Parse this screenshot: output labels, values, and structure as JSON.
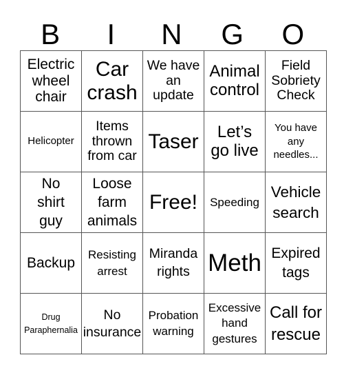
{
  "header": {
    "letters": [
      "B",
      "I",
      "N",
      "G",
      "O"
    ]
  },
  "grid": {
    "rows": [
      [
        "Electric wheel chair",
        "Car crash",
        "We have an update",
        "Animal control",
        "Field Sobriety Check"
      ],
      [
        "Helicopter",
        "Items thrown from car",
        "Taser",
        "Let’s go live",
        "You have any needles..."
      ],
      [
        "No shirt guy",
        "Loose farm animals",
        "Free!",
        "Speeding",
        "Vehicle search"
      ],
      [
        "Backup",
        "Resisting arrest",
        "Miranda rights",
        "Meth",
        "Expired tags"
      ],
      [
        "Drug Paraphernalia",
        "No insurance",
        "Probation warning",
        "Excessive hand gestures",
        "Call for rescue"
      ]
    ]
  }
}
